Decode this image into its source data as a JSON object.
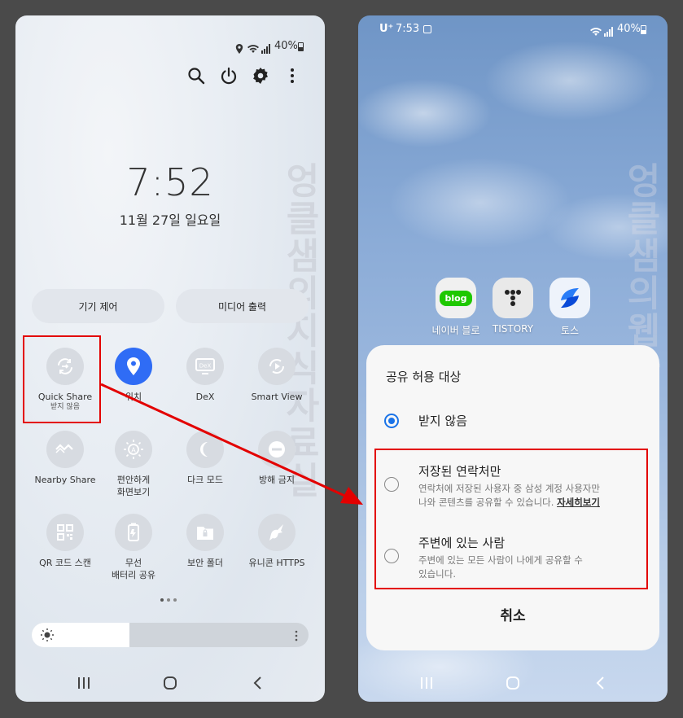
{
  "left_phone": {
    "status": {
      "battery": "40%"
    },
    "clock": {
      "time": "7:52",
      "date": "11월 27일 일요일"
    },
    "pills": {
      "device_control": "기기 제어",
      "media_output": "미디어 출력"
    },
    "tiles": [
      {
        "label": "Quick Share",
        "sub": "받지 않음"
      },
      {
        "label": "위치",
        "sub": ""
      },
      {
        "label": "DeX",
        "sub": ""
      },
      {
        "label": "Smart View",
        "sub": ""
      },
      {
        "label": "Nearby Share",
        "sub": ""
      },
      {
        "label": "편안하게",
        "sub": "화면보기"
      },
      {
        "label": "다크 모드",
        "sub": ""
      },
      {
        "label": "방해 금지",
        "sub": ""
      },
      {
        "label": "QR 코드 스캔",
        "sub": ""
      },
      {
        "label": "무선",
        "sub": "배터리 공유"
      },
      {
        "label": "보안 폴더",
        "sub": ""
      },
      {
        "label": "유니콘 HTTPS",
        "sub": ""
      }
    ],
    "watermark": "엉클샘의지식자료실"
  },
  "right_phone": {
    "status": {
      "carrier": "U⁺",
      "time": "7:53",
      "battery": "40%"
    },
    "apps": [
      {
        "label": "네이버 블로그",
        "icon_text": "blog",
        "color": "#1ec800"
      },
      {
        "label": "TISTORY",
        "icon_text": "T",
        "color": "#e9e9e9"
      },
      {
        "label": "토스",
        "icon_text": "toss",
        "color": "#0064ff"
      }
    ],
    "sheet": {
      "title": "공유 허용 대상",
      "option1": "받지 않음",
      "option2_title": "저장된 연락처만",
      "option2_desc_1": "연락처에 저장된 사용자 중 삼성 계정 사용자만",
      "option2_desc_2": "나와 콘텐츠를 공유할 수 있습니다.",
      "option2_link": "자세히보기",
      "option3_title": "주변에 있는 사람",
      "option3_desc_1": "주변에 있는 모든 사람이 나에게 공유할 수",
      "option3_desc_2": "있습니다.",
      "cancel": "취소"
    },
    "watermark": "엉클샘의웹자료실"
  },
  "colors": {
    "accent_blue": "#1a73e8",
    "highlight_red": "#e30000",
    "location_blue": "#2f6cf5"
  }
}
